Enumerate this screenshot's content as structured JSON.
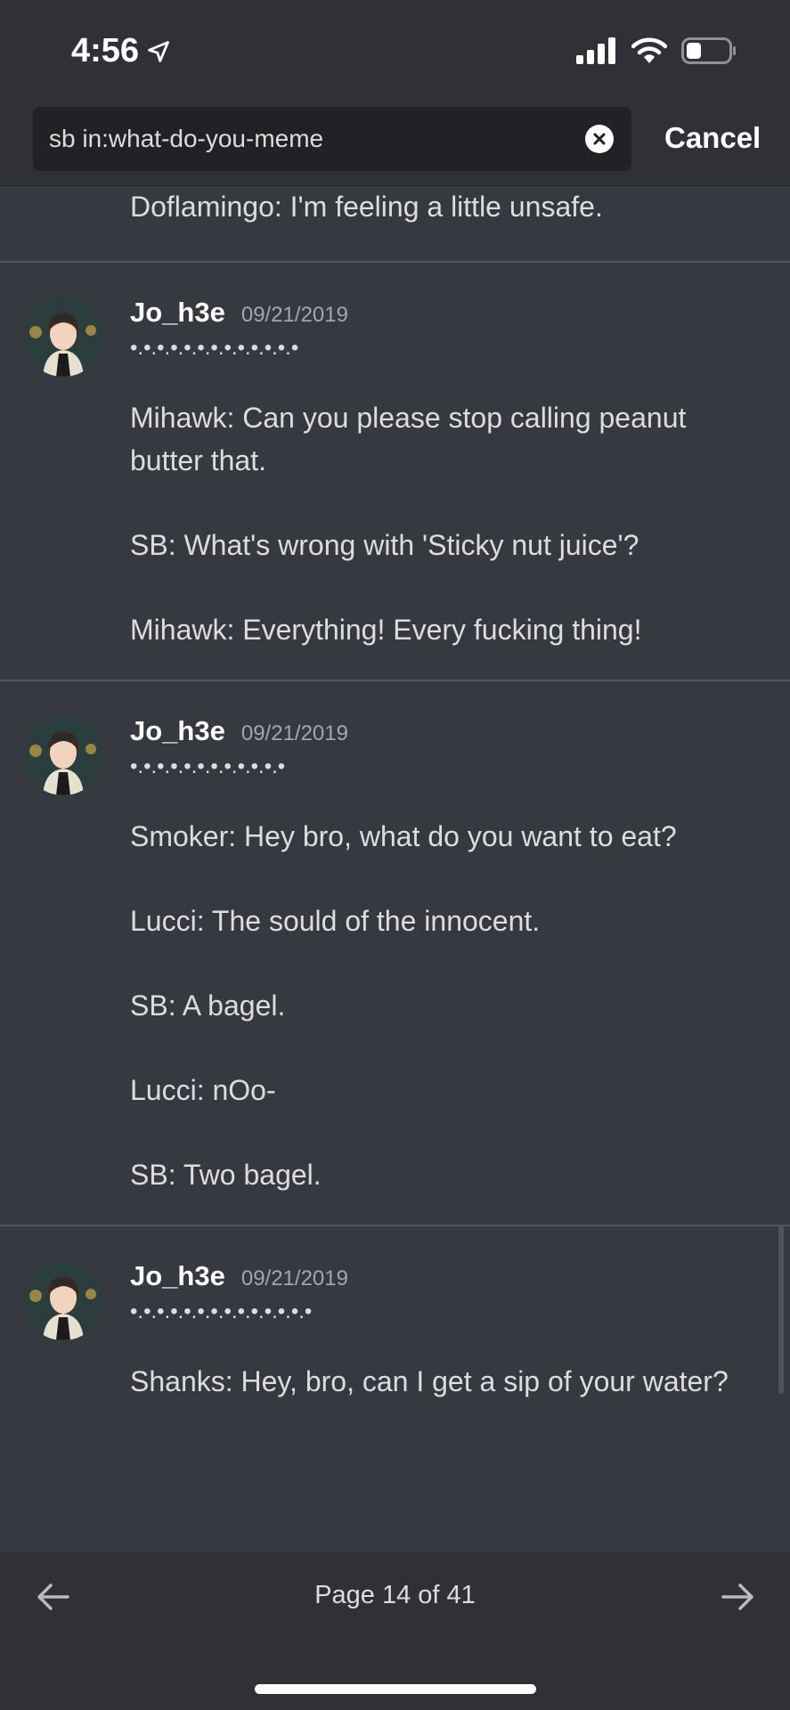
{
  "status_bar": {
    "time": "4:56",
    "icons": [
      "location-arrow-icon",
      "signal-icon",
      "wifi-icon",
      "battery-icon"
    ]
  },
  "search": {
    "query": "sb in:what-do-you-meme",
    "cancel_label": "Cancel"
  },
  "partial_message": {
    "text": "Doflamingo: I'm feeling a little unsafe."
  },
  "messages": [
    {
      "username": "Jo_h3e",
      "timestamp": "09/21/2019",
      "dots": "•.•.•.•.•.•.•.•.•.•.•.•.•",
      "lines": [
        "Mihawk: Can you please stop calling peanut butter that.",
        "SB: What's wrong with 'Sticky nut juice'?",
        "Mihawk: Everything! Every fucking thing!"
      ]
    },
    {
      "username": "Jo_h3e",
      "timestamp": "09/21/2019",
      "dots": "•.•.•.•.•.•.•.•.•.•.•.•",
      "lines": [
        "Smoker: Hey bro, what do you want to eat?",
        "Lucci: The sould of the innocent.",
        "SB: A bagel.",
        "Lucci: nOo-",
        "SB: Two bagel."
      ]
    },
    {
      "username": "Jo_h3e",
      "timestamp": "09/21/2019",
      "dots": "•.•.•.•.•.•.•.•.•.•.•.•.•.•",
      "lines": [
        "Shanks: Hey, bro, can I get a sip of your water?"
      ]
    }
  ],
  "pagination": {
    "label": "Page 14 of 41"
  },
  "colors": {
    "background": "#36393f",
    "header": "#2f3136",
    "search_box": "#202225",
    "divider": "#4f545c"
  }
}
